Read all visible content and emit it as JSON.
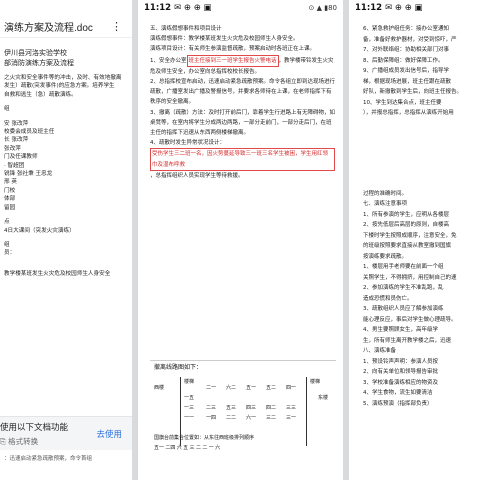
{
  "left_phone": {
    "title": "演练方案及流程.doc",
    "lines": [
      "伊川县河洛实验学校",
      "部消防演练方案及流程",
      "之火灾和安全事件等的冲击，及时、有效地撤离",
      "发生）疏散(突发事件)的应急方案。培养学生",
      "自救和逃生（急）疏散演练。",
      "组",
      "安    张改萍",
      "校委会成员及班主任",
      "长    张改萍",
      "张改萍",
      "门及任课教师",
      "     · 智超团",
      "锐锋    张社秉    王忠龙",
      "     邢    英",
      "门校",
      "体部",
      "留园",
      "点",
      "4日大课间（突发火灾演练）",
      "组",
      "员：",
      "教学楼某班发生火灾危及校园师生人身安全"
    ],
    "banner": {
      "text": "使用以下文档功能",
      "sub": "格式转换",
      "button": "去使用"
    },
    "bottom_line": "：迅速启动紧急疏散预案，命令首组"
  },
  "mid_phone": {
    "time": "11:12",
    "status_icons": "✉ ⊕ ⊕ ▣",
    "status_right": "⊙ ▲ ▮80",
    "lines": [
      "五、演练假想事件和项目设计",
      "演练假想事件：教学楼某班发生火灾危及校园师生人身安全。",
      "演练项目设计：有关师生参演监督疏散，预案启动时各班正在上课。",
      "1、安全办公室{r}，教学楼带铃发生火灾危及师生安全，办公室向总指挥校校长报告。",
      "2、总指挥校宣布启动，迅速启动紧急疏散预案。命令各组立即到达现场进行疏散，广播室发出广播及警报信号，并要求各师待在上课，在老师指挥下有秩序的安全撤离。",
      "3、撤离（疏散）方法：及时打开前后门，靠着学生行进路上有无障碍物，如桌凳等，在室内将学生分成两边两路，一部分走前门，一部分走后门，在班主任的指挥下迅速从东西两侧楼梯撤离。",
      "4、疏散时发生异常状况设计：",
      "受伤学生三二班一名，因火势蔓延导致三一班三名学生被困，学生用红领巾及湿布呼救，总指挥组织人员实现学生等待救援。"
    ],
    "red_box_1": "班主任接到三一班学生报告火警电话",
    "red_box_2": "受伤学生三二班一名，因火势蔓延导致三一班三名学生被困，学生用红领巾及湿布呼救",
    "diagram_title": "撤离线路图如下：",
    "diagram_labels": [
      "西楼",
      "楼梯",
      "一五",
      "一三",
      "一一",
      "二一",
      "二三",
      "六二",
      "五三",
      "四三",
      "五二",
      "四二",
      "一四",
      "五一",
      "六一",
      "四一",
      "三三",
      "二二",
      "三二",
      "三一",
      "楼梯",
      "东楼"
    ],
    "footer_lines": [
      "国旗台前集合位置如：从东往西班级排列顺序",
      "五一   二四   六   五   三   二   二  一  六"
    ]
  },
  "right_phone": {
    "time": "11:12",
    "status_icons": "✉ ⊕ ⊕ ▣",
    "lines": [
      "6、紧急救护组任务：接办公室通知",
      "备，准备好救护器材，对受到惊吓，严",
      "7、对外联络组：协助相关部门对事",
      "8、后勤保障组：做好保障工作。",
      "9、广播组成员发出信号后，指导学",
      "梯，根据现场进展，班主任跟在疏散",
      "好队，新撤散到学生后，向班主任报告。",
      "10、学生到达集合点，班主任要",
      "），并报总指挥，总指挥从演练开始用",
      "过程的准确时间。",
      "七、演练注意事项",
      "1、所有参演的学生，应明从各楼层",
      "2、按先低层后高层的原则，自楼高",
      "下楼时学生按照成顺序，注意安全，免",
      "的班级按照要求直接从教室撤到国旗",
      "按演练要求疏散。",
      "1、楼层用手老师要在前面一个组",
      "关照学生，不得拥挤，用控制自己的速",
      "2、参加演练的学生不准乱跑，乱",
      "造成恐慌和员伤亡。",
      "3、疏散组织人员应了解参加演练",
      "能心理反应，事后对学生做心理疏导。",
      "4、男生要照顾女生，高年级学",
      "生，所有师生离开教学楼之后，迅速",
      "八、演练准备",
      "1、预设铃声声明：参演人员按",
      "2、向有关单位和领导报告审批",
      "3、学校准备演练相应的物资及",
      "4、学生食物，流生如要清洁",
      "5、演练预演（指挥部负责）"
    ]
  }
}
